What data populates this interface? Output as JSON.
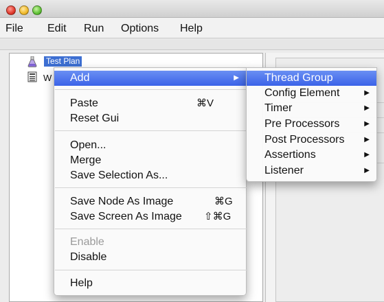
{
  "menubar": {
    "items": [
      "File",
      "Edit",
      "Run",
      "Options",
      "Help"
    ]
  },
  "tree": {
    "items": [
      {
        "label": "Test Plan",
        "icon": "flask-icon",
        "selected": true
      },
      {
        "label": "W",
        "icon": "workbench-icon",
        "selected": false
      }
    ]
  },
  "context_menu": {
    "add": {
      "label": "Add",
      "arrow": "▶"
    },
    "paste": {
      "label": "Paste",
      "shortcut": "⌘V"
    },
    "reset_gui": {
      "label": "Reset Gui"
    },
    "open": {
      "label": "Open..."
    },
    "merge": {
      "label": "Merge"
    },
    "save_selection": {
      "label": "Save Selection As..."
    },
    "save_node_image": {
      "label": "Save Node As Image",
      "shortcut": "⌘G"
    },
    "save_screen_image": {
      "label": "Save Screen As Image",
      "shortcut": "⇧⌘G"
    },
    "enable": {
      "label": "Enable",
      "disabled": true
    },
    "disable": {
      "label": "Disable"
    },
    "help": {
      "label": "Help"
    }
  },
  "submenu": {
    "items": [
      {
        "label": "Thread Group",
        "arrow": ""
      },
      {
        "label": "Config Element",
        "arrow": "▶"
      },
      {
        "label": "Timer",
        "arrow": "▶"
      },
      {
        "label": "Pre Processors",
        "arrow": "▶"
      },
      {
        "label": "Post Processors",
        "arrow": "▶"
      },
      {
        "label": "Assertions",
        "arrow": "▶"
      },
      {
        "label": "Listener",
        "arrow": "▶"
      }
    ]
  },
  "colors": {
    "selection": "#3d6fd2",
    "menu_highlight": "#3b63e8"
  }
}
